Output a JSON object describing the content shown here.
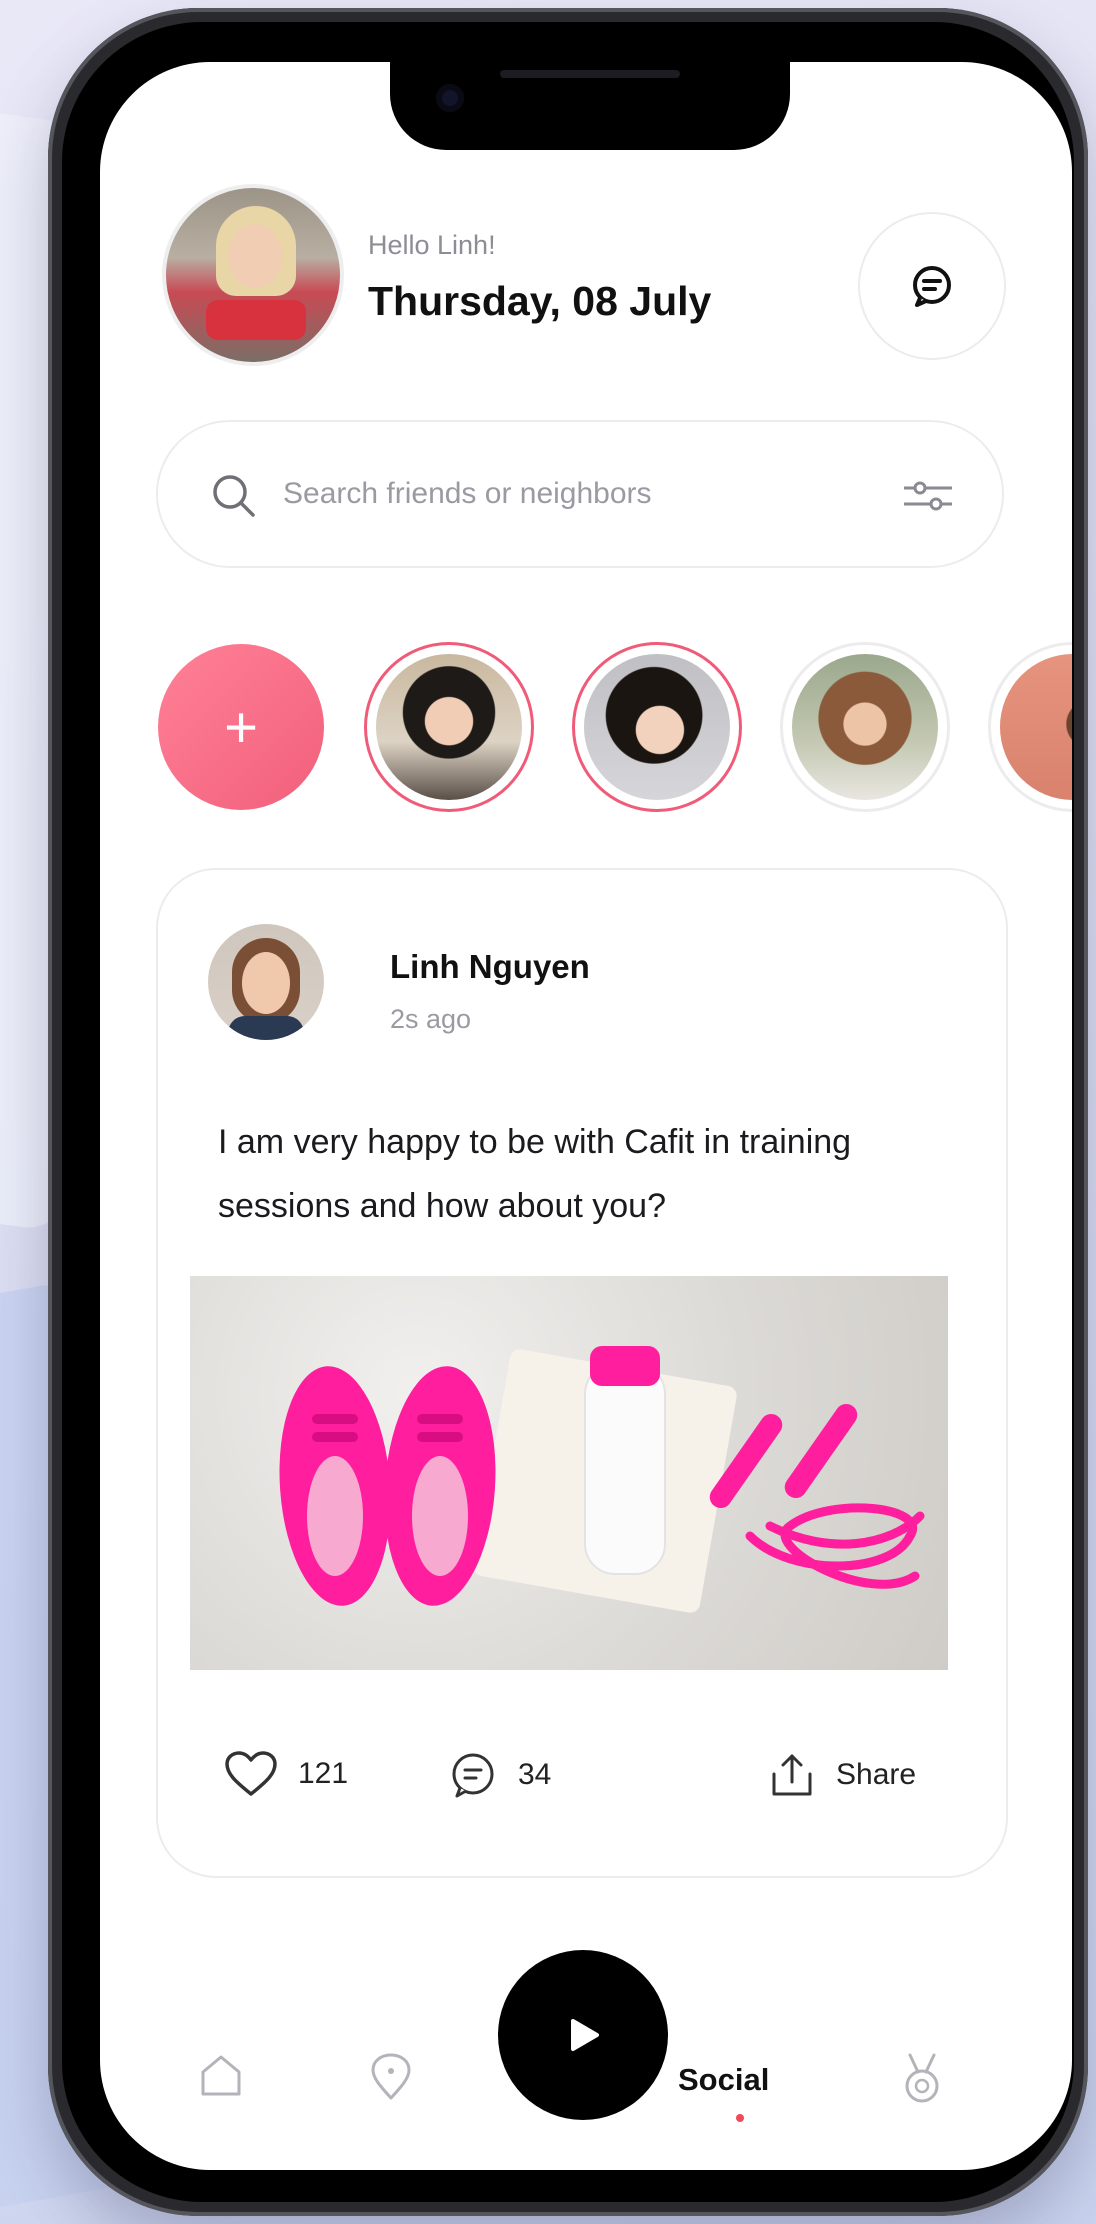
{
  "header": {
    "greeting": "Hello Linh!",
    "date": "Thursday, 08 July"
  },
  "search": {
    "placeholder": "Search friends or neighbors"
  },
  "stories": {
    "add_label": "+"
  },
  "post": {
    "author": "Linh Nguyen",
    "time": "2s ago",
    "text": "I am very happy to be with Cafit in training sessions and how about you?",
    "likes": "121",
    "comments": "34",
    "share_label": "Share"
  },
  "nav": {
    "active_label": "Social"
  },
  "colors": {
    "accent": "#ef5b78",
    "pink_product": "#ff1f9e",
    "dark": "#000000"
  },
  "icons": [
    "chat-icon",
    "search-icon",
    "filter-icon",
    "plus-icon",
    "heart-icon",
    "comment-icon",
    "share-icon",
    "play-icon",
    "home-icon",
    "location-icon",
    "medal-icon"
  ]
}
